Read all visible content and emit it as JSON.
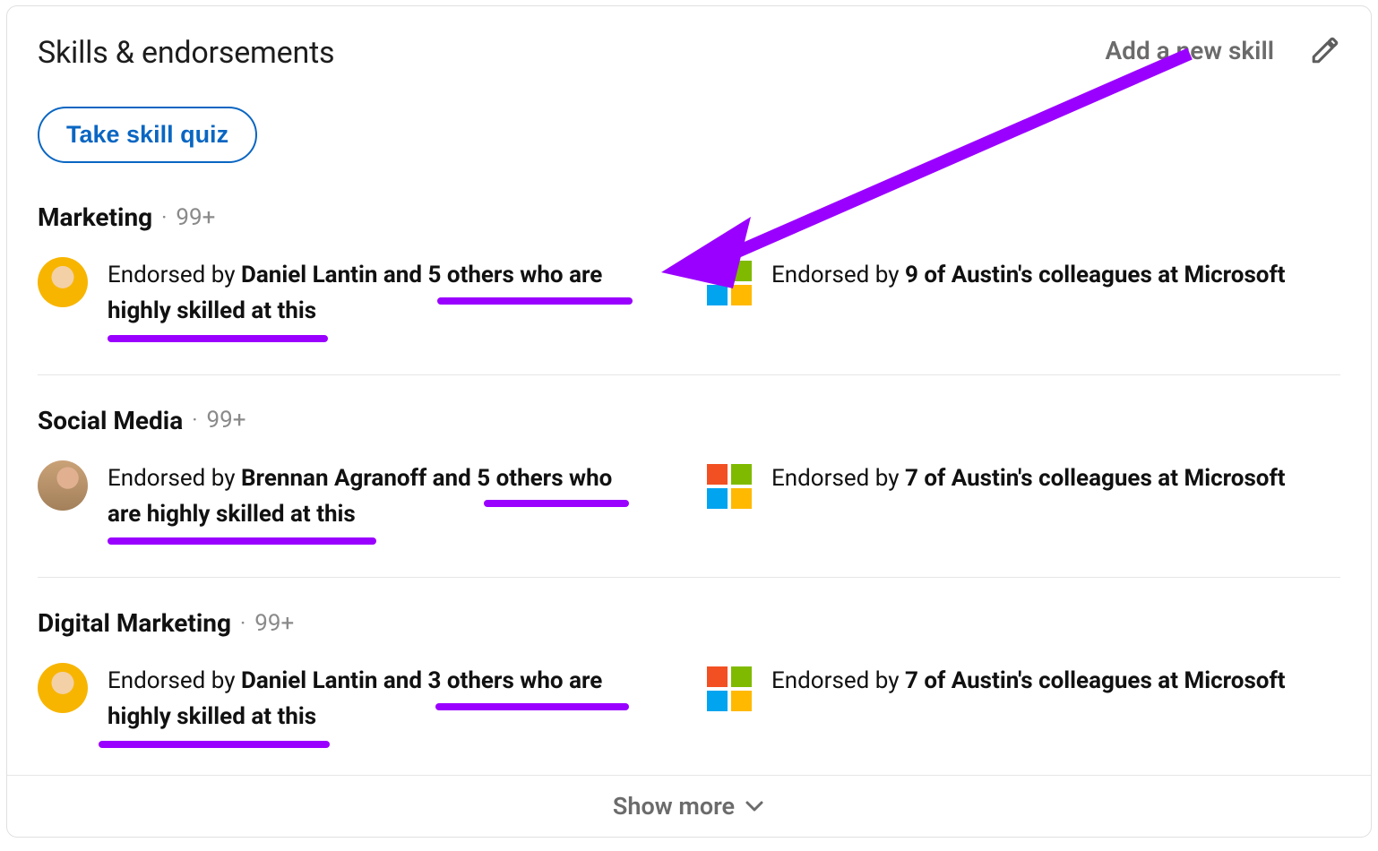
{
  "header": {
    "title": "Skills & endorsements",
    "add_skill_label": "Add a new skill"
  },
  "quiz_button_label": "Take skill quiz",
  "show_more_label": "Show more",
  "skills": [
    {
      "name": "Marketing",
      "count_label": "99+",
      "person_endorse_prefix": "Endorsed by ",
      "person_endorse_bold": "Daniel Lantin and 5 others who are highly skilled at this",
      "company_endorse_prefix": "Endorsed by ",
      "company_endorse_bold": "9 of Austin's colleagues at Microsoft",
      "avatar_variant": "1"
    },
    {
      "name": "Social Media",
      "count_label": "99+",
      "person_endorse_prefix": "Endorsed by ",
      "person_endorse_bold": "Brennan Agranoff and 5 others who are highly skilled at this",
      "company_endorse_prefix": "Endorsed by ",
      "company_endorse_bold": "7 of Austin's colleagues at Microsoft",
      "avatar_variant": "2"
    },
    {
      "name": "Digital Marketing",
      "count_label": "99+",
      "person_endorse_prefix": "Endorsed by ",
      "person_endorse_bold": "Daniel Lantin and 3 others who are highly skilled at this",
      "company_endorse_prefix": "Endorsed by ",
      "company_endorse_bold": "7 of Austin's colleagues at Microsoft",
      "avatar_variant": "1"
    }
  ],
  "annotation": {
    "color": "#9a00ff",
    "underlines_width": {
      "a": 218,
      "b": 246,
      "c": 300,
      "d": 162,
      "e": 218,
      "f": 258
    }
  }
}
